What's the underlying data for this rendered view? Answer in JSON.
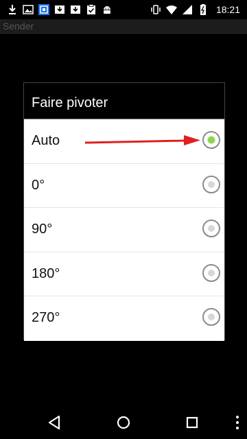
{
  "status_bar": {
    "time": "18:21",
    "left_icons": [
      "download-icon",
      "image-icon",
      "app-icon",
      "cast-icon",
      "download-box-icon",
      "clipboard-icon",
      "android-icon"
    ],
    "right_icons": [
      "vibrate-icon",
      "wifi-icon",
      "signal-icon",
      "battery-icon"
    ]
  },
  "app": {
    "title": "Sender"
  },
  "dialog": {
    "title": "Faire pivoter",
    "options": [
      {
        "label": "Auto",
        "selected": true
      },
      {
        "label": "0°",
        "selected": false
      },
      {
        "label": "90°",
        "selected": false
      },
      {
        "label": "180°",
        "selected": false
      },
      {
        "label": "270°",
        "selected": false
      }
    ]
  },
  "annotation": {
    "arrow_color": "#e02020"
  },
  "nav": {
    "buttons": [
      "back-icon",
      "home-icon",
      "recents-icon",
      "more-icon"
    ]
  },
  "colors": {
    "radio_selected": "#8bd64b",
    "dialog_header": "#000000"
  }
}
